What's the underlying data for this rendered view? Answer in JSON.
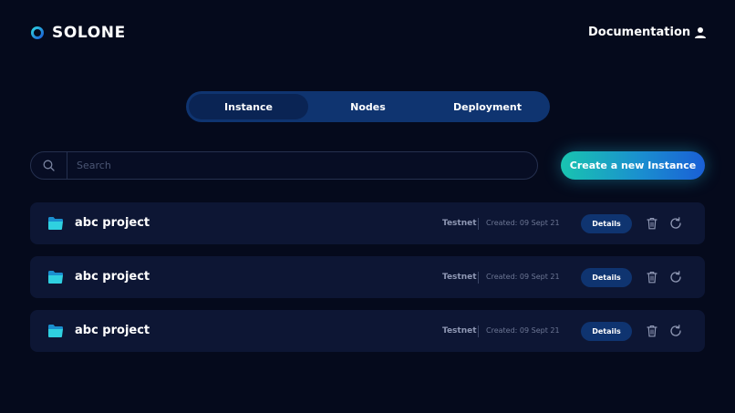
{
  "header": {
    "brand": "SOLONE",
    "nav_link": "Documentation",
    "logo_icon": "solone-ring-logo",
    "user_icon": "user-icon"
  },
  "tabs": [
    {
      "label": "Instance",
      "active": true
    },
    {
      "label": "Nodes",
      "active": false
    },
    {
      "label": "Deployment",
      "active": false
    }
  ],
  "search": {
    "placeholder": "Search",
    "value": "",
    "icon": "search-icon"
  },
  "actions": {
    "create_label": "Create a new Instance"
  },
  "instances": [
    {
      "name": "abc project",
      "network": "Testnet",
      "created": "Created: 09 Sept 21",
      "details_label": "Details"
    },
    {
      "name": "abc project",
      "network": "Testnet",
      "created": "Created: 09 Sept 21",
      "details_label": "Details"
    },
    {
      "name": "abc project",
      "network": "Testnet",
      "created": "Created: 09 Sept 21",
      "details_label": "Details"
    }
  ],
  "colors": {
    "background": "#050a1c",
    "card": "#0d1634",
    "tab_bar": "#0f3470",
    "tab_active": "#0a2454",
    "accent_start": "#19c4b0",
    "accent_end": "#1a5fd6"
  }
}
